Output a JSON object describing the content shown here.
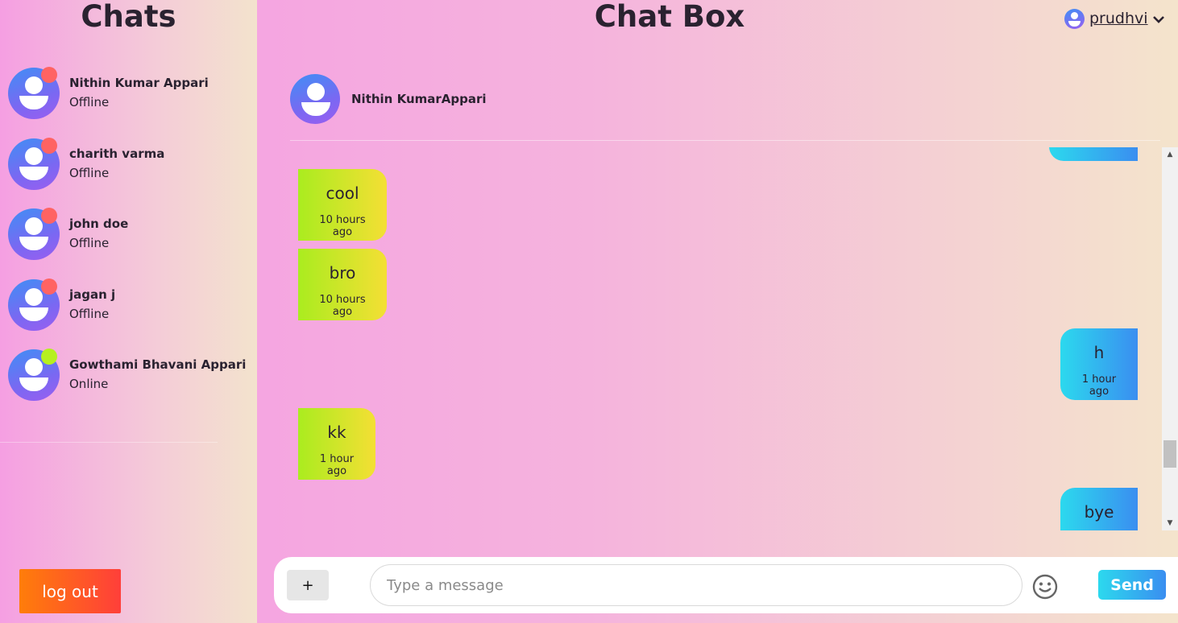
{
  "sidebar": {
    "title": "Chats",
    "contacts": [
      {
        "name": "Nithin Kumar Appari",
        "status": "Offline"
      },
      {
        "name": "charith varma",
        "status": "Offline"
      },
      {
        "name": "john doe",
        "status": "Offline"
      },
      {
        "name": "jagan j",
        "status": "Offline"
      },
      {
        "name": "Gowthami Bhavani Appari",
        "status": "Online"
      }
    ],
    "logout_label": "log out"
  },
  "header": {
    "title": "Chat Box",
    "username": "prudhvi",
    "chevron": "❯"
  },
  "chat": {
    "active_name": "Nithin KumarAppari",
    "messages": [
      {
        "text": "cool",
        "time": "10 hours ago",
        "direction": "received"
      },
      {
        "text": "bro",
        "time": "10 hours ago",
        "direction": "received"
      },
      {
        "text": "h",
        "time": "1 hour ago",
        "direction": "sent"
      },
      {
        "text": "kk",
        "time": "1 hour ago",
        "direction": "received"
      },
      {
        "text": "bye",
        "time": "",
        "direction": "sent"
      }
    ]
  },
  "composer": {
    "attach_label": "+",
    "placeholder": "Type a message",
    "send_label": "Send",
    "emoji_icon": "smiley-icon"
  },
  "colors": {
    "online_dot": "#b6f01f",
    "offline_dot": "#ff6363",
    "sent_bubble": "#3a8ef0",
    "received_bubble": "#aaec1f",
    "logout": "#ff5a25"
  }
}
